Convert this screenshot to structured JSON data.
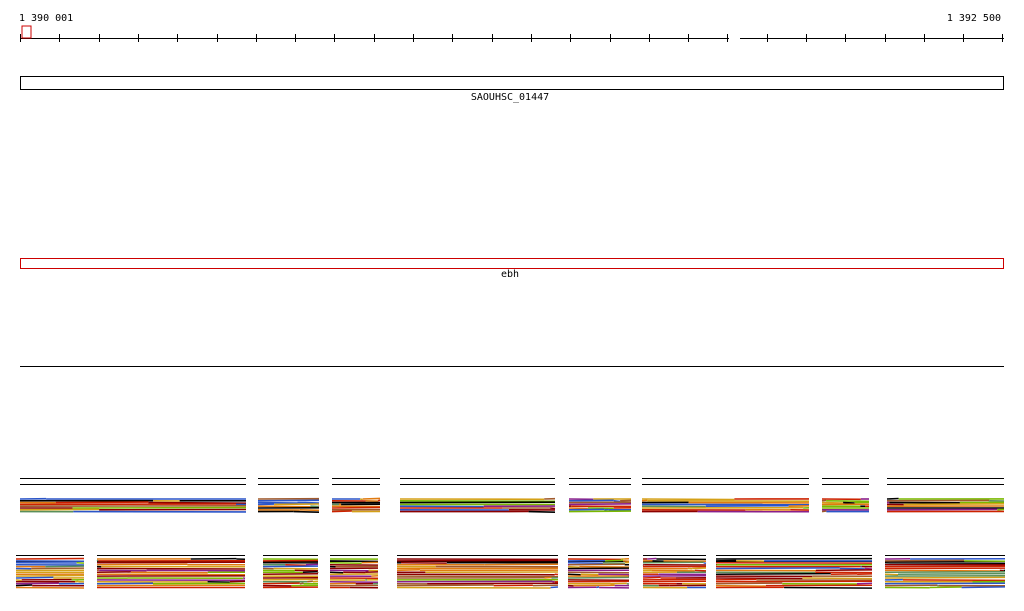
{
  "ruler": {
    "start_label": "1 390 001",
    "end_label": "1 392 500"
  },
  "features": [
    {
      "id": "SAOUHSC_01447",
      "label": "SAOUHSC_01447",
      "color": "#000000"
    },
    {
      "id": "ebh",
      "label": "ebh",
      "color": "#cc0000"
    }
  ],
  "colors": {
    "ruler": "#000000",
    "highlight": "#cc0000",
    "alignment_palette": [
      "#000000",
      "#cc2200",
      "#e07a10",
      "#7ab800",
      "#2b55c8",
      "#8a1f8a",
      "#a05a2c",
      "#d4a017",
      "#5a8f5a",
      "#8b0000",
      "#ffffff"
    ]
  }
}
